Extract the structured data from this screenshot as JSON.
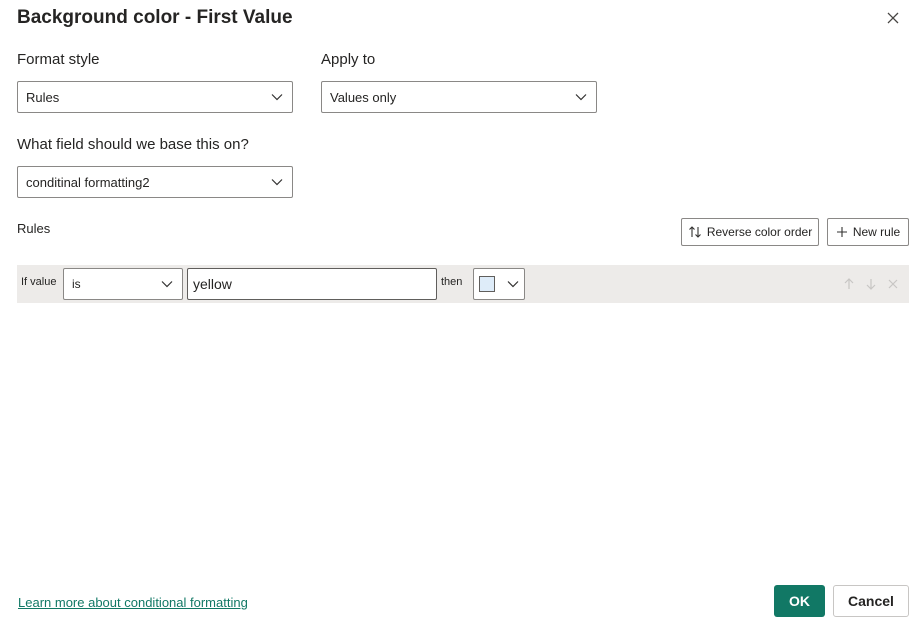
{
  "dialog": {
    "title": "Background color - First Value"
  },
  "format_style": {
    "label": "Format style",
    "value": "Rules"
  },
  "apply_to": {
    "label": "Apply to",
    "value": "Values only"
  },
  "base_field": {
    "label": "What field should we base this on?",
    "value": "conditinal formatting2"
  },
  "rules": {
    "label": "Rules",
    "reverse_label": "Reverse color order",
    "new_rule_label": "New rule",
    "items": [
      {
        "prefix": "If value",
        "operator": "is",
        "value": "yellow",
        "then_label": "then",
        "color": "#deecf9"
      }
    ]
  },
  "footer": {
    "learn_more": "Learn more about conditional formatting",
    "ok_label": "OK",
    "cancel_label": "Cancel"
  },
  "colors": {
    "accent": "#117865",
    "rule_row_bg": "#edebe9"
  }
}
